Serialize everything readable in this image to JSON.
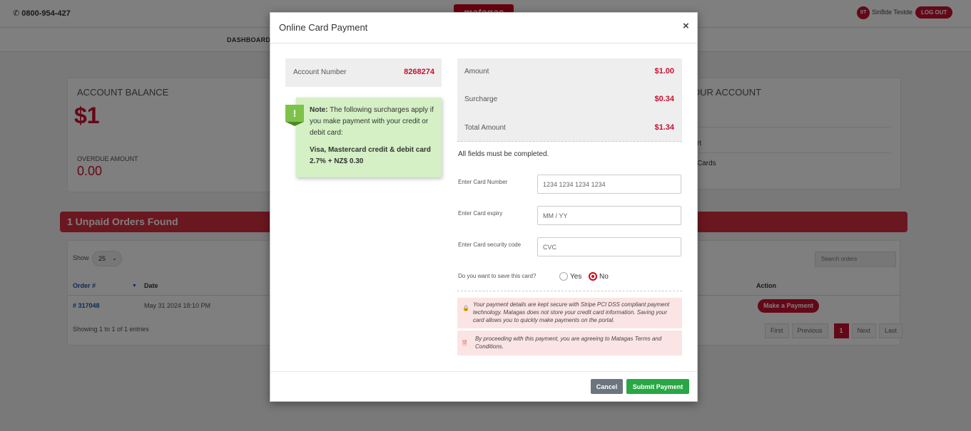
{
  "header": {
    "phone": "0800-954-427",
    "logo": "matagas",
    "avatar_initials": "ST",
    "username": "Siri8de Testde",
    "logout_label": "LOG OUT"
  },
  "nav": {
    "dashboard": "DASHBOARD"
  },
  "balance": {
    "title": "ACCOUNT BALANCE",
    "value": "$1",
    "overdue_label": "OVERDUE AMOUNT",
    "overdue_value": "0.00"
  },
  "your_account": {
    "title": "OUR ACCOUNT",
    "item1": "rt",
    "item2": "Cards"
  },
  "unpaid": {
    "title": "1 Unpaid Orders Found"
  },
  "table": {
    "show_label": "Show",
    "show_value": "25",
    "search_placeholder": "Search orders",
    "columns": {
      "order": "Order #",
      "date": "Date",
      "action": "Action"
    },
    "rows": [
      {
        "order": "# 317048",
        "date": "May 31 2024 18:10 PM",
        "action": "Make a Payment"
      }
    ],
    "showing": "Showing 1 to 1 of 1 entries",
    "pager": {
      "first": "First",
      "previous": "Previous",
      "current": "1",
      "next": "Next",
      "last": "Last"
    }
  },
  "modal": {
    "title": "Online Card Payment",
    "close": "×",
    "account_label": "Account Number",
    "account_number": "8268274",
    "note_flag": "!",
    "note_prefix": "Note:",
    "note_text": " The following surcharges apply if you make payment with your credit or debit card:",
    "note_cards": "Visa, Mastercard credit & debit card 2.7% + NZ$ 0.30",
    "summary": {
      "amount_label": "Amount",
      "amount": "$1.00",
      "surcharge_label": "Surcharge",
      "surcharge": "$0.34",
      "total_label": "Total Amount",
      "total": "$1.34"
    },
    "all_fields": "All fields must be completed.",
    "card_number": {
      "label": "Enter Card Number",
      "placeholder": "1234 1234 1234 1234",
      "value": ""
    },
    "card_expiry": {
      "label": "Enter Card expiry",
      "placeholder": "MM / YY",
      "value": ""
    },
    "card_cvc": {
      "label": "Enter Card security code",
      "placeholder": "CVC",
      "value": ""
    },
    "save_question": "Do you want to save this card?",
    "save_yes": "Yes",
    "save_no": "No",
    "save_selected": "No",
    "security_text": "Your payment details are kept secure with Stripe PCI DSS compliant payment technology. Matagas does not store your credit card information. Saving your card allows you to quickly make payments on the portal.",
    "terms_text": "By proceeding with this payment, you are agreeing to Matagas Terms and Conditions.",
    "cancel_label": "Cancel",
    "submit_label": "Submit Payment"
  },
  "colors": {
    "brand_red": "#c8102e",
    "submit_green": "#28a745",
    "note_green": "#d4f0c4"
  }
}
